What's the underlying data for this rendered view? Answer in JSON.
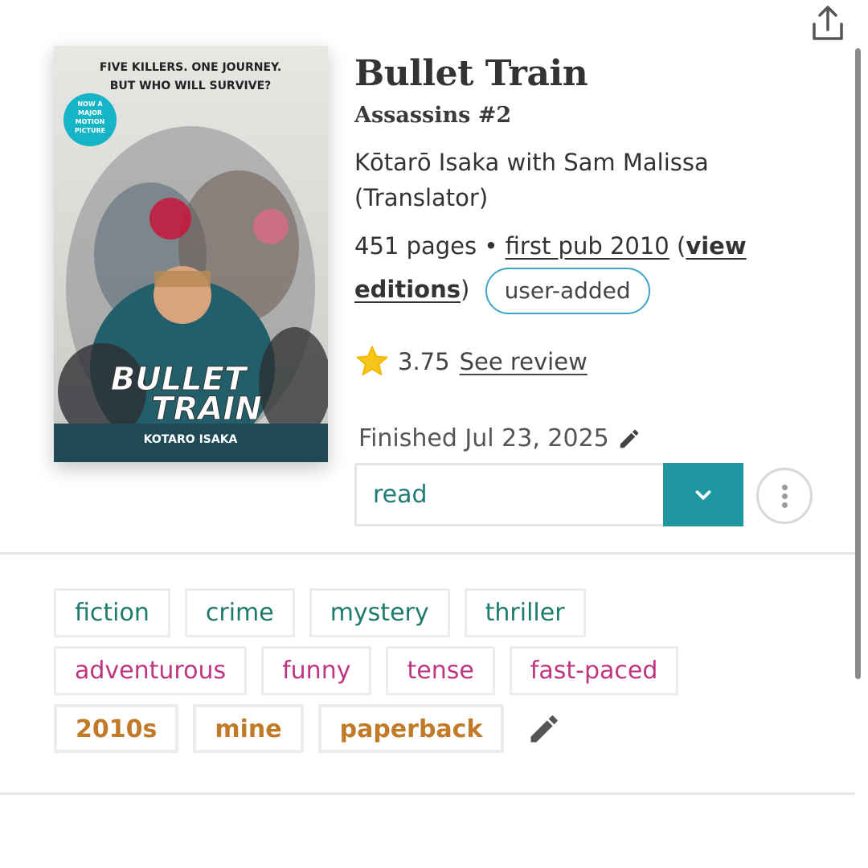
{
  "book": {
    "title": "Bullet Train",
    "series": "Assassins #2",
    "authors": "Kōtarō Isaka with Sam Malissa (Translator)",
    "pages": "451 pages",
    "separator": "•",
    "first_pub": "first pub 2010",
    "open_paren": "(",
    "view_editions": "view editions",
    "close_paren": ")",
    "badge": "user-added"
  },
  "cover": {
    "tagline_line1": "FIVE KILLERS. ONE JOURNEY.",
    "tagline_line2": "BUT WHO WILL SURVIVE?",
    "badge_line1": "NOW A",
    "badge_line2": "MAJOR",
    "badge_line3": "MOTION",
    "badge_line4": "PICTURE",
    "title_line1": "BULLET",
    "title_line2": "TRAIN",
    "author": "KOTARO ISAKA"
  },
  "rating": {
    "icon": "star-icon",
    "score": "3.75",
    "review_link": "See review"
  },
  "reading": {
    "finished": "Finished Jul 23, 2025",
    "status": "read"
  },
  "tags": {
    "genres": [
      "fiction",
      "crime",
      "mystery",
      "thriller"
    ],
    "moods": [
      "adventurous",
      "funny",
      "tense",
      "fast-paced"
    ],
    "misc": [
      "2010s",
      "mine",
      "paperback"
    ]
  },
  "colors": {
    "accent": "#1e97a0",
    "badge_border": "#3aa6c8",
    "star": "#f5c518",
    "genre_tag": "#1e7a6b",
    "mood_tag": "#c0357f",
    "misc_tag": "#c17a28"
  }
}
